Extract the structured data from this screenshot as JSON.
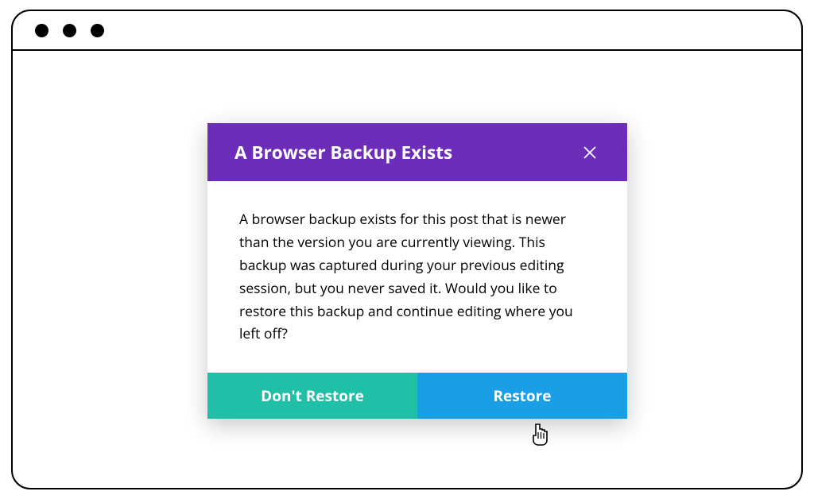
{
  "modal": {
    "title": "A Browser Backup Exists",
    "body": "A browser backup exists for this post that is newer than the version you are currently viewing. This backup was captured during your previous editing session, but you never saved it. Would you like to restore this backup and continue editing where you left off?",
    "dont_restore_label": "Don't Restore",
    "restore_label": "Restore"
  },
  "colors": {
    "header": "#6c2eb9",
    "dont_restore": "#1fbfa8",
    "restore": "#1a9ee5"
  }
}
